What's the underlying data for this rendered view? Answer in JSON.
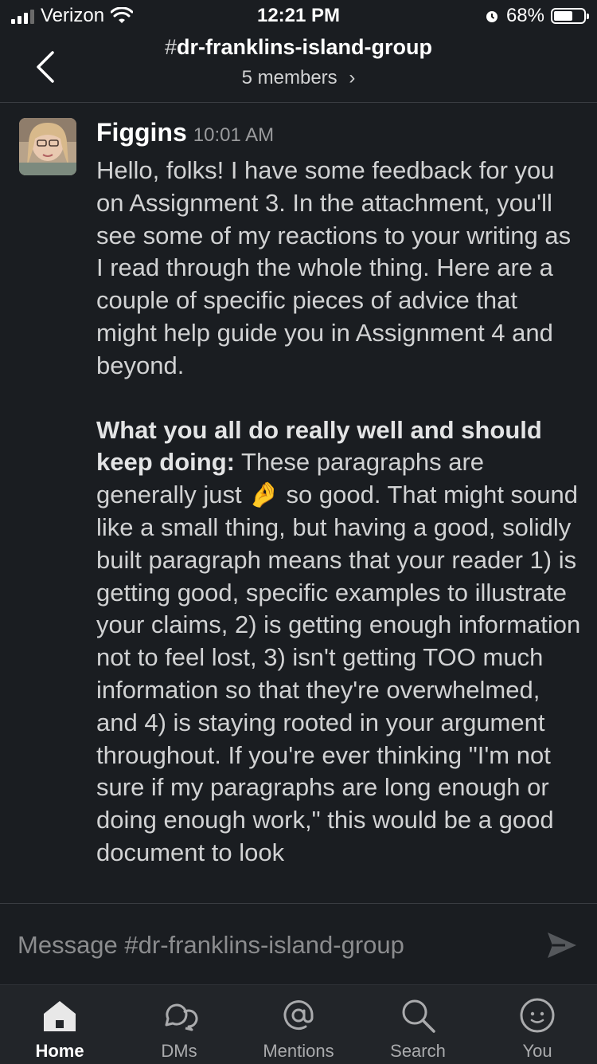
{
  "status_bar": {
    "carrier": "Verizon",
    "time": "12:21 PM",
    "battery": "68%",
    "battery_level": 0.68
  },
  "header": {
    "hash": "#",
    "channel_name": "dr-franklins-island-group",
    "members": "5 members",
    "members_chevron": "›"
  },
  "message": {
    "author": "Figgins",
    "timestamp": "10:01 AM",
    "paragraph1": "Hello, folks! I have some feedback for you on Assignment 3. In the attachment, you'll see some of my reactions to your writing as I read through the whole thing. Here are a couple of specific pieces of advice that might help guide you in Assignment 4 and beyond.",
    "p2_bold": "What you all do really well and should keep doing:",
    "p2_before_emoji": " These paragraphs are generally just ",
    "p2_emoji": "🤌",
    "p2_after_emoji": " so good. That might sound like a small thing, but having a good, solidly built paragraph means that your reader 1) is getting good, specific examples to illustrate your claims, 2) is getting enough information not to feel lost, 3) isn't getting TOO much information so that they're overwhelmed, and 4) is staying rooted in your argument throughout. If you're ever thinking \"I'm not sure if my paragraphs are long enough or doing enough work,\" this would be a good document to look"
  },
  "composer": {
    "placeholder": "Message #dr-franklins-island-group"
  },
  "tabs": [
    {
      "label": "Home",
      "icon": "home-icon",
      "active": true
    },
    {
      "label": "DMs",
      "icon": "dms-icon",
      "active": false
    },
    {
      "label": "Mentions",
      "icon": "mentions-icon",
      "active": false
    },
    {
      "label": "Search",
      "icon": "search-icon",
      "active": false
    },
    {
      "label": "You",
      "icon": "you-icon",
      "active": false
    }
  ],
  "colors": {
    "background": "#1a1d21",
    "tabbar": "#222529",
    "text": "#d1d2d3",
    "muted": "#8b8c8e"
  }
}
